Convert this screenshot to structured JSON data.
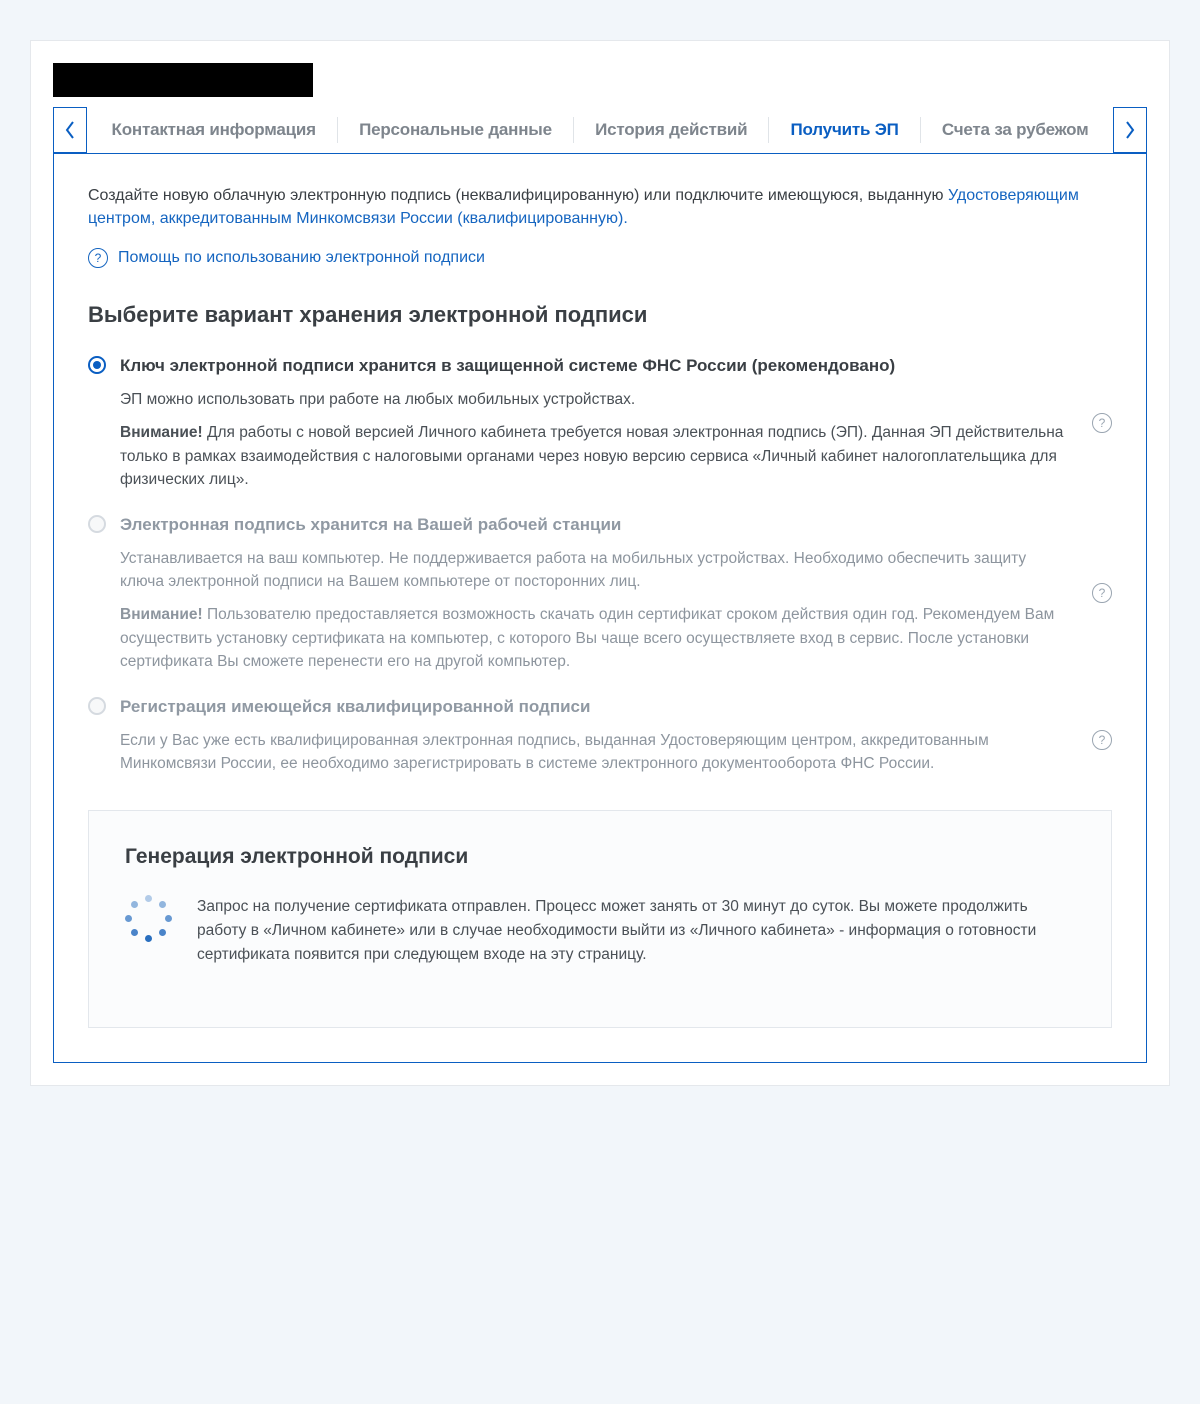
{
  "intro": {
    "prefix": "Создайте новую облачную электронную подпись (неквалифицированную) или подключите имеющуюся, выданную ",
    "link": "Удостоверяющим центром, аккредитованным Минкомсвязи России (квалифицированную)."
  },
  "help_link": "Помощь по использованию электронной подписи",
  "section_title": "Выберите вариант хранения электронной подписи",
  "tabs": [
    "Контактная информация",
    "Персональные данные",
    "История действий",
    "Получить ЭП",
    "Счета за рубежом"
  ],
  "active_tab_index": 3,
  "options": [
    {
      "title": "Ключ электронной подписи хранится в защищенной системе ФНС России (рекомендовано)",
      "desc": "ЭП можно использовать при работе на любых мобильных устройствах.",
      "warn_label": "Внимание!",
      "warn_text": " Для работы с новой версией Личного кабинета требуется новая электронная подпись (ЭП). Данная ЭП  действительна только в рамках взаимодействия с налоговыми органами через новую версию сервиса  «Личный кабинет налогоплательщика для физических лиц».",
      "selected": true,
      "disabled": false
    },
    {
      "title": "Электронная подпись хранится на Вашей рабочей станции",
      "desc": "Устанавливается на ваш компьютер. Не поддерживается работа на мобильных устройствах. Необходимо обеспечить  защиту ключа электронной подписи на Вашем компьютере от посторонних лиц.",
      "warn_label": "Внимание!",
      "warn_text": " Пользователю предоставляется возможность скачать один сертификат  сроком действия один год. Рекомендуем Вам осуществить установку сертификата на компьютер, с которого Вы  чаще всего осуществляете вход в сервис. После установки сертификата Вы сможете перенести его на другой компьютер.",
      "selected": false,
      "disabled": true
    },
    {
      "title": "Регистрация имеющейся квалифицированной подписи",
      "desc": "Если у Вас уже есть квалифицированная электронная подпись, выданная Удостоверяющим центром, аккредитованным Минкомсвязи России, ее необходимо зарегистрировать в системе электронного документооборота ФНС России.",
      "warn_label": "",
      "warn_text": "",
      "selected": false,
      "disabled": true
    }
  ],
  "generation": {
    "title": "Генерация электронной подписи",
    "text": "Запрос на получение сертификата отправлен. Процесс может занять от 30 минут до суток. Вы можете продолжить работу в «Личном кабинете» или в случае необходимости выйти из «Личного кабинета» - информация о готовности сертификата появится при следующем входе на эту страницу."
  }
}
